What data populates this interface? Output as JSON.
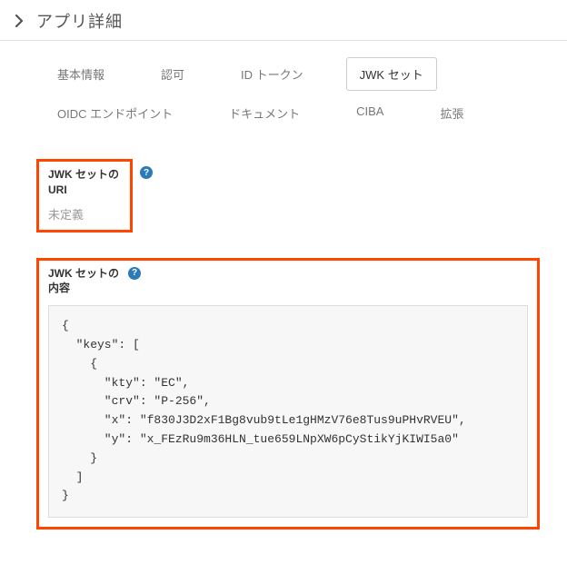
{
  "header": {
    "title": "アプリ詳細"
  },
  "tabs": {
    "items": [
      {
        "label": "基本情報"
      },
      {
        "label": "認可"
      },
      {
        "label": "ID トークン"
      },
      {
        "label": "JWK セット"
      },
      {
        "label": "OIDC エンドポイント"
      },
      {
        "label": "ドキュメント"
      },
      {
        "label": "CIBA"
      },
      {
        "label": "拡張"
      }
    ],
    "activeIndex": 3
  },
  "sections": {
    "jwkUri": {
      "heading": "JWK セットの URI",
      "value": "未定義"
    },
    "jwkContent": {
      "heading": "JWK セットの内容",
      "code": "{\n  \"keys\": [\n    {\n      \"kty\": \"EC\",\n      \"crv\": \"P-256\",\n      \"x\": \"f830J3D2xF1Bg8vub9tLe1gHMzV76e8Tus9uPHvRVEU\",\n      \"y\": \"x_FEzRu9m36HLN_tue659LNpXW6pCyStikYjKIWI5a0\"\n    }\n  ]\n}"
    }
  }
}
